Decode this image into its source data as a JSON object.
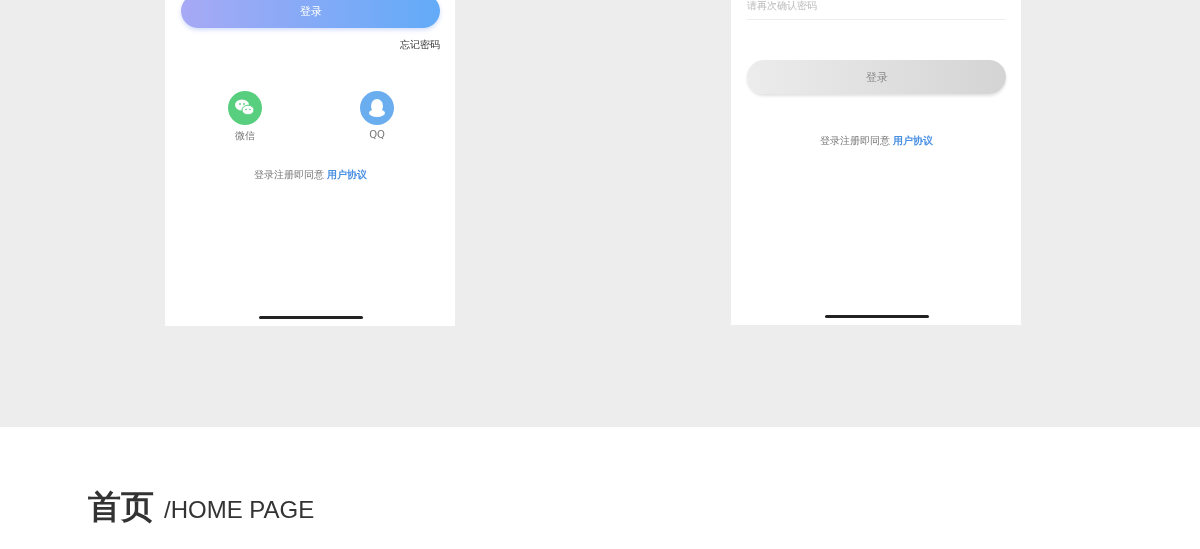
{
  "screens": [
    {
      "kind": "login",
      "login_button": {
        "label": "登录",
        "disabled": false
      },
      "forgot_password": "忘记密码",
      "social": [
        {
          "kind": "wechat",
          "label": "微信"
        },
        {
          "kind": "qq",
          "label": "QQ"
        }
      ],
      "agreement": {
        "text": "登录注册即同意",
        "link": "用户协议"
      }
    },
    {
      "kind": "register",
      "confirm_field": {
        "placeholder": "请再次确认密码"
      },
      "login_button": {
        "label": "登录",
        "disabled": true
      },
      "agreement": {
        "text": "登录注册即同意",
        "link": "用户协议"
      }
    }
  ],
  "section": {
    "title": "首页",
    "subtitle": "/HOME PAGE"
  }
}
